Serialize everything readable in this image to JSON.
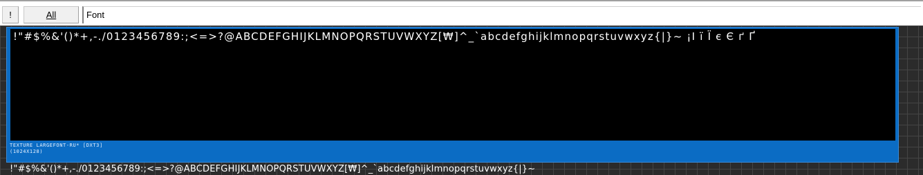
{
  "toolbar": {
    "bang_label": "!",
    "all_label": "All",
    "font_field_value": "Font"
  },
  "texture": {
    "glyphs": "!\"#$%&'()*+,-./0123456789:;<=>?@ABCDEFGHIJKLMNOPQRSTUVWXYZ[₩]^_`abcdefghijklmnopqrstuvwxyz{|}~ ¡Ι ï Ï є Є ґ Ґ",
    "info_line1": "TEXTURE LARGEFONT-RU* [DXT3]",
    "info_line2": "(1024X128)"
  },
  "preview": {
    "text": "!\"#$%&'()*+,-./0123456789:;<=>?@ABCDEFGHIJKLMNOPQRSTUVWXYZ[₩]^_`abcdefghijklmnopqrstuvwxyz{|}~"
  },
  "colors": {
    "frame_blue": "#0b6cc4",
    "canvas": "#000000",
    "workspace": "#2b2b2b"
  }
}
